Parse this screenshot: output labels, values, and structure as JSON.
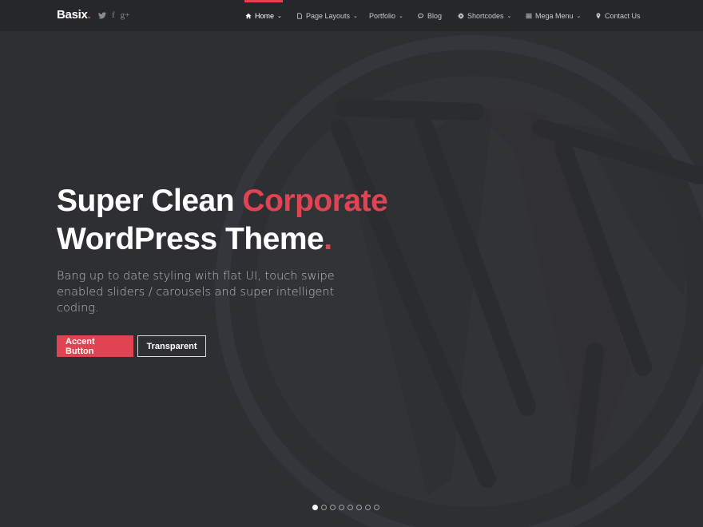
{
  "brand": {
    "name": "Basix",
    "dot": "."
  },
  "social": [
    {
      "icon": "twitter-icon",
      "glyph": ""
    },
    {
      "icon": "facebook-icon",
      "glyph": "f"
    },
    {
      "icon": "google-plus-icon",
      "glyph": "g+"
    }
  ],
  "nav": {
    "items": [
      {
        "label": "Home",
        "icon": "home-icon",
        "dropdown": true,
        "active": true
      },
      {
        "label": "Page Layouts",
        "icon": "page-icon",
        "dropdown": true
      },
      {
        "label": "Portfolio",
        "icon": "",
        "dropdown": true
      },
      {
        "label": "Blog",
        "icon": "chat-icon",
        "dropdown": false
      },
      {
        "label": "Shortcodes",
        "icon": "gear-icon",
        "dropdown": true
      },
      {
        "label": "Mega Menu",
        "icon": "list-icon",
        "dropdown": true
      },
      {
        "label": "Contact Us",
        "icon": "map-pin-icon",
        "dropdown": false
      }
    ]
  },
  "hero": {
    "line1_a": "Super Clean ",
    "line1_b": "Corporate",
    "line2": "WordPress Theme",
    "line2_dot": ".",
    "subtext": "Bang up to date styling with flat UI, touch swipe enabled sliders / carousels and super intelligent coding.",
    "primary_button": "Accent Button",
    "secondary_button": "Transparent"
  },
  "slider": {
    "count": 8,
    "active_index": 0
  },
  "colors": {
    "accent": "#e04452",
    "background": "#2e2f33",
    "navbar": "#26272a"
  }
}
